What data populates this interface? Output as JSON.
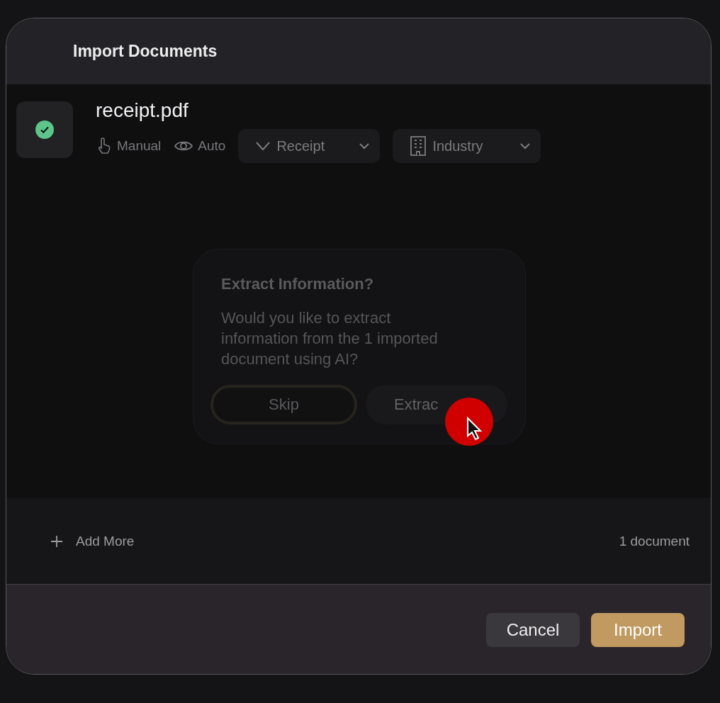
{
  "window": {
    "title": "Import Documents"
  },
  "file": {
    "name": "receipt.pdf",
    "checked": true,
    "modes": [
      {
        "label": "Manual",
        "kind": "manual"
      },
      {
        "label": "Auto",
        "kind": "auto"
      }
    ],
    "type_select": {
      "value": "Receipt"
    },
    "category_select": {
      "value": "Industry"
    }
  },
  "prompt": {
    "title": "Extract Information?",
    "message": "Would you like to extract information from the 1 imported document using AI?",
    "buttons": [
      {
        "label": "Skip",
        "kind": "secondary"
      },
      {
        "label": "Extrac",
        "kind": "primary"
      }
    ]
  },
  "add_more": "Add More",
  "count": "1 document",
  "actions": [
    {
      "label": "Cancel",
      "kind": "secondary"
    },
    {
      "label": "Import",
      "kind": "primary"
    }
  ]
}
